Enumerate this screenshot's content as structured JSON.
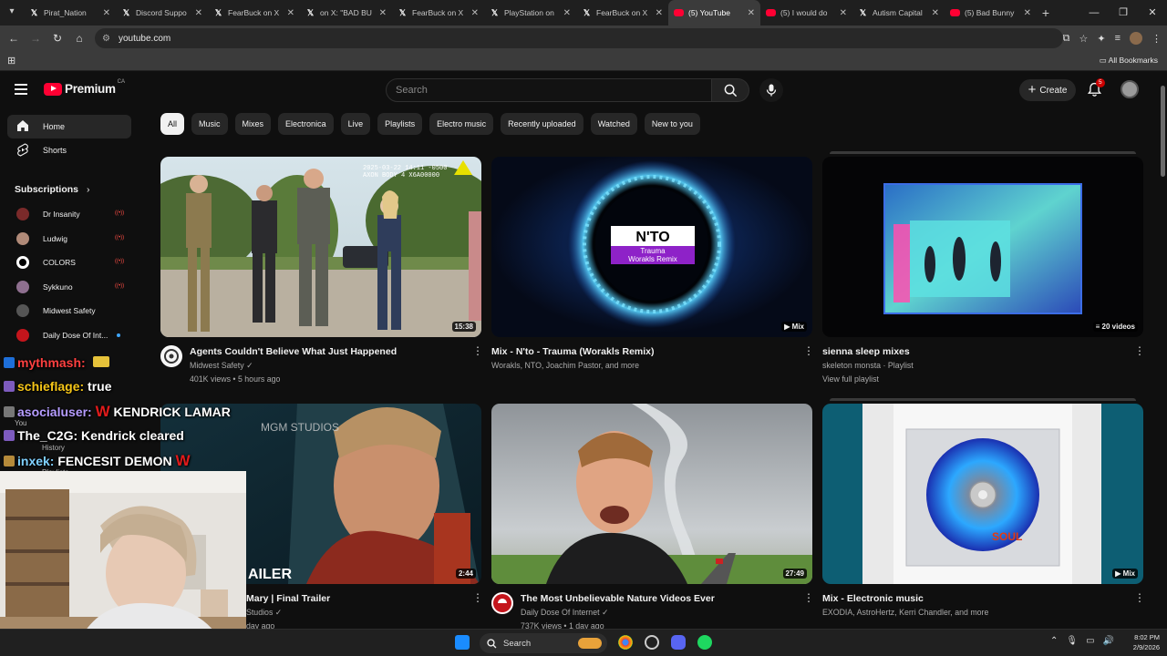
{
  "browser": {
    "tabs": [
      {
        "title": "Pirat_Nation",
        "icon": "x-icon",
        "active": false
      },
      {
        "title": "Discord Suppo",
        "icon": "x-icon",
        "active": false
      },
      {
        "title": "FearBuck on X",
        "icon": "x-icon",
        "active": false
      },
      {
        "title": "on X: \"BAD BU",
        "icon": "x-icon",
        "active": false
      },
      {
        "title": "FearBuck on X",
        "icon": "x-icon",
        "active": false
      },
      {
        "title": "PlayStation on",
        "icon": "x-icon",
        "active": false
      },
      {
        "title": "FearBuck on X",
        "icon": "x-icon",
        "active": false
      },
      {
        "title": "(5) YouTube",
        "icon": "youtube-icon",
        "active": true
      },
      {
        "title": "(5) I would do",
        "icon": "youtube-icon",
        "active": false
      },
      {
        "title": "Autism Capital",
        "icon": "x-icon",
        "active": false
      },
      {
        "title": "(5) Bad Bunny",
        "icon": "youtube-icon",
        "active": false
      }
    ],
    "url": "youtube.com",
    "bookmarks_label": "All Bookmarks"
  },
  "youtube": {
    "brand": "Premium",
    "country": "CA",
    "search_placeholder": "Search",
    "create_label": "Create",
    "notification_count": "5",
    "nav": {
      "home": "Home",
      "shorts": "Shorts",
      "subscriptions": "Subscriptions"
    },
    "channels": [
      {
        "name": "Dr Insanity",
        "status": "live",
        "color": "#7a2a2a"
      },
      {
        "name": "Ludwig",
        "status": "live",
        "color": "#b08a78"
      },
      {
        "name": "COLORS",
        "status": "live",
        "color": "#ffffff"
      },
      {
        "name": "Sykkuno",
        "status": "live",
        "color": "#8e6f8f"
      },
      {
        "name": "Midwest Safety",
        "status": "",
        "color": "#555555"
      },
      {
        "name": "Daily Dose Of Int...",
        "status": "new",
        "color": "#c4151c"
      }
    ],
    "chips": [
      "All",
      "Music",
      "Mixes",
      "Electronica",
      "Live",
      "Playlists",
      "Electro music",
      "Recently uploaded",
      "Watched",
      "New to you"
    ],
    "videos": [
      {
        "title": "Agents Couldn't Believe What Just Happened",
        "channel": "Midwest Safety",
        "line3": "401K views • 5 hours ago",
        "badge": "15:38",
        "verified": true
      },
      {
        "title": "Mix - N'to - Trauma (Worakls Remix)",
        "channel": "Worakls, NTO, Joachim Pastor, and more",
        "line3": "",
        "badge": "Mix",
        "verified": false
      },
      {
        "title": "sienna sleep mixes",
        "channel": "skeleton monsta · Playlist",
        "line3": "View full playlist",
        "badge": "20 videos",
        "verified": false
      },
      {
        "title": "Mary | Final Trailer",
        "channel": "Studios",
        "line3": "day ago",
        "badge": "2:44",
        "verified": true
      },
      {
        "title": "The Most Unbelievable Nature Videos Ever",
        "channel": "Daily Dose Of Internet",
        "line3": "737K views • 1 day ago",
        "badge": "27:49",
        "verified": true
      },
      {
        "title": "Mix - Electronic music",
        "channel": "EXODIA, AstroHertz, Kerri Chandler, and more",
        "line3": "",
        "badge": "Mix",
        "verified": false
      }
    ],
    "thumb_text": {
      "nto_line1": "N'TO",
      "nto_line2": "Trauma",
      "nto_line3": "Worakls Remix",
      "trailer_text": "AILER",
      "studio_text": "MGM STUDIOS"
    }
  },
  "stream_overlay": {
    "chat": [
      {
        "user": "mythmash:",
        "text": ""
      },
      {
        "user": "schieflage:",
        "text": "true"
      },
      {
        "user": "asocialuser:",
        "text": "KENDRICK LAMAR"
      },
      {
        "user": "The_C2G:",
        "text": "Kendrick cleared"
      },
      {
        "user": "inxek:",
        "text": "FENCESIT DEMON"
      }
    ],
    "faded_labels": [
      "You",
      "History",
      "Playlists"
    ]
  },
  "taskbar": {
    "search_label": "Search",
    "time": "8:02 PM",
    "date": "2/9/2026"
  }
}
